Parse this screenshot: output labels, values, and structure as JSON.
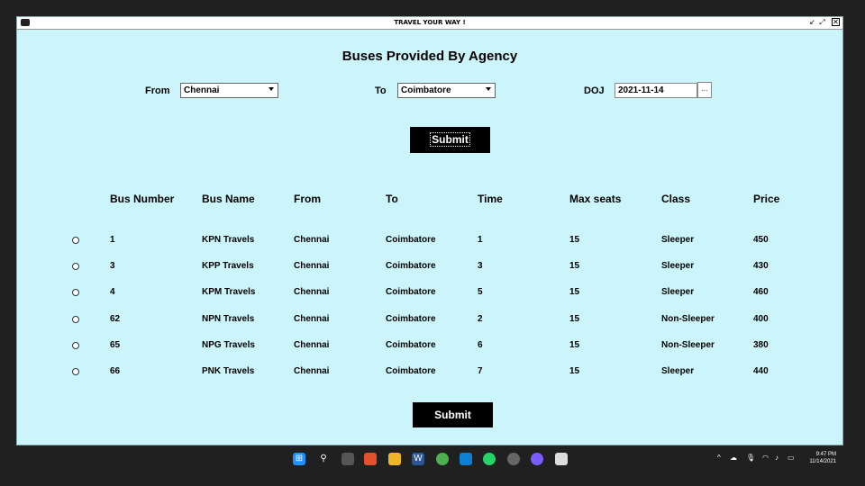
{
  "window": {
    "title": "TRAVEL YOUR WAY !"
  },
  "page": {
    "heading": "Buses Provided By Agency"
  },
  "form": {
    "from_label": "From",
    "from_value": "Chennai",
    "to_label": "To",
    "to_value": "Coimbatore",
    "doj_label": "DOJ",
    "doj_value": "2021-11-14",
    "date_picker_label": "...",
    "submit_label": "Submit"
  },
  "table": {
    "headers": [
      "Bus Number",
      "Bus Name",
      "From",
      "To",
      "Time",
      "Max seats",
      "Class",
      "Price"
    ],
    "rows": [
      [
        "1",
        "KPN Travels",
        "Chennai",
        "Coimbatore",
        "1",
        "15",
        "Sleeper",
        "450"
      ],
      [
        "3",
        "KPP Travels",
        "Chennai",
        "Coimbatore",
        "3",
        "15",
        "Sleeper",
        "430"
      ],
      [
        "4",
        "KPM Travels",
        "Chennai",
        "Coimbatore",
        "5",
        "15",
        "Sleeper",
        "460"
      ],
      [
        "62",
        "NPN Travels",
        "Chennai",
        "Coimbatore",
        "2",
        "15",
        "Non-Sleeper",
        "400"
      ],
      [
        "65",
        "NPG Travels",
        "Chennai",
        "Coimbatore",
        "6",
        "15",
        "Non-Sleeper",
        "380"
      ],
      [
        "66",
        "PNK Travels",
        "Chennai",
        "Coimbatore",
        "7",
        "15",
        "Sleeper",
        "440"
      ]
    ]
  },
  "bottom": {
    "submit_label": "Submit"
  },
  "taskbar": {
    "time": "9:47 PM",
    "date": "11/14/2021",
    "icons": [
      "windows-start-icon",
      "search-icon",
      "task-view-icon",
      "brave-icon",
      "file-explorer-icon",
      "word-icon",
      "chrome-icon",
      "vscode-icon",
      "whatsapp-icon",
      "media-icon",
      "app-icon",
      "bus-app-icon"
    ]
  },
  "colors": {
    "window_bg": "#ccf5fb",
    "button_bg": "#000000",
    "taskbar_bg": "#202020"
  }
}
